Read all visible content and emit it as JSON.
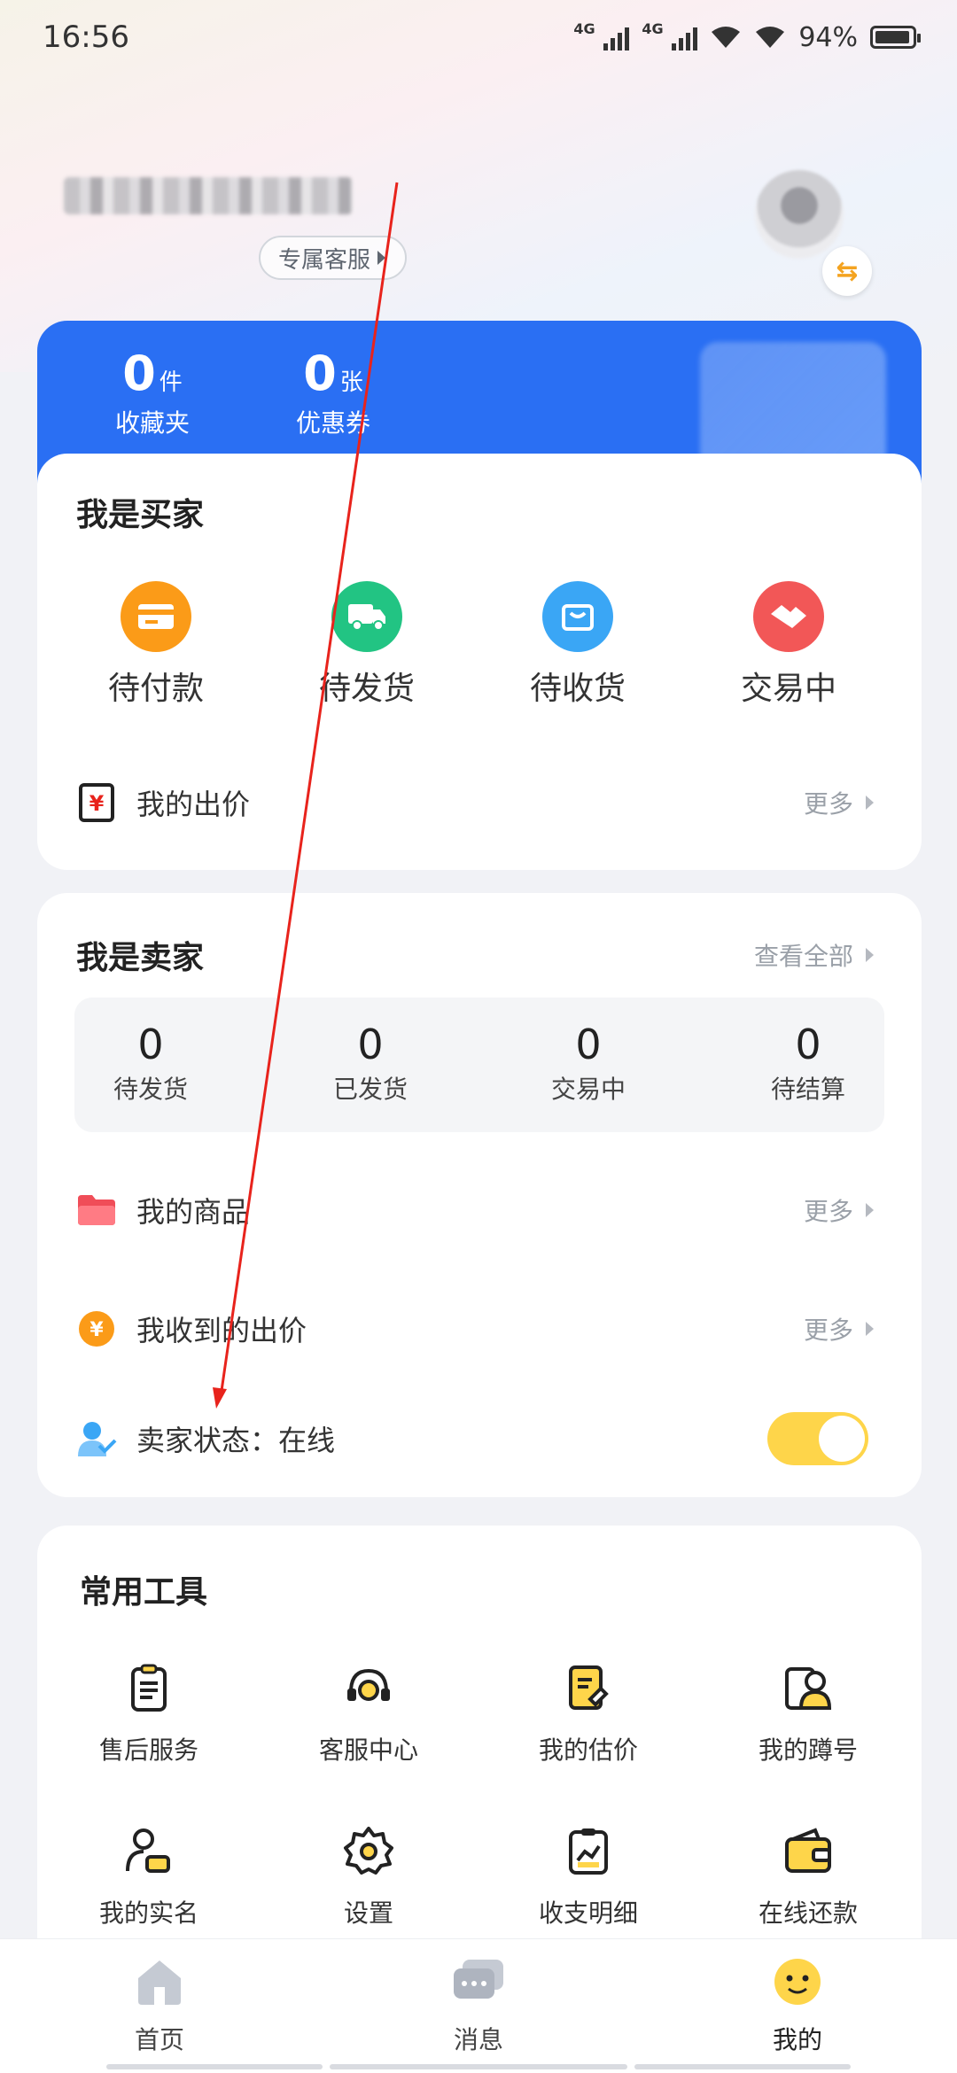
{
  "status_bar": {
    "time": "16:56",
    "network_1": "4G",
    "network_2": "4G",
    "battery": "94%",
    "battery_level": 0.94
  },
  "profile": {
    "service_label": "专属客服"
  },
  "stats": [
    {
      "value": "0",
      "unit": "件",
      "label": "收藏夹"
    },
    {
      "value": "0",
      "unit": "张",
      "label": "优惠券"
    }
  ],
  "buyer": {
    "title": "我是买家",
    "orders": [
      {
        "label": "待付款",
        "icon": "wallet-card-icon",
        "color": "#fb9b18"
      },
      {
        "label": "待发货",
        "icon": "truck-icon",
        "color": "#22c483"
      },
      {
        "label": "待收货",
        "icon": "bag-icon",
        "color": "#3aa6f5"
      },
      {
        "label": "交易中",
        "icon": "handshake-icon",
        "color": "#f25757"
      }
    ],
    "bid_label": "我的出价",
    "more_label": "更多"
  },
  "seller": {
    "title": "我是卖家",
    "view_all": "查看全部",
    "stats": [
      {
        "value": "0",
        "label": "待发货"
      },
      {
        "value": "0",
        "label": "已发货"
      },
      {
        "value": "0",
        "label": "交易中"
      },
      {
        "value": "0",
        "label": "待结算"
      }
    ],
    "rows": [
      {
        "label": "我的商品",
        "more": "更多"
      },
      {
        "label": "我收到的出价",
        "more": "更多"
      }
    ],
    "status_label": "卖家状态：在线",
    "status_on": true
  },
  "tools": {
    "title": "常用工具",
    "items": [
      {
        "label": "售后服务",
        "icon": "clipboard-icon"
      },
      {
        "label": "客服中心",
        "icon": "headset-icon"
      },
      {
        "label": "我的估价",
        "icon": "appraisal-icon"
      },
      {
        "label": "我的蹲号",
        "icon": "watch-list-icon"
      },
      {
        "label": "我的实名",
        "icon": "id-user-icon"
      },
      {
        "label": "设置",
        "icon": "gear-icon"
      },
      {
        "label": "收支明细",
        "icon": "statement-icon"
      },
      {
        "label": "在线还款",
        "icon": "wallet-icon"
      }
    ]
  },
  "nav": [
    {
      "label": "首页",
      "icon": "home-icon"
    },
    {
      "label": "消息",
      "icon": "message-icon"
    },
    {
      "label": "我的",
      "icon": "profile-face-icon"
    }
  ],
  "colors": {
    "primary_blue": "#2a6ff3",
    "toggle_yellow": "#fed54a",
    "annotation_red": "#e8231c"
  }
}
